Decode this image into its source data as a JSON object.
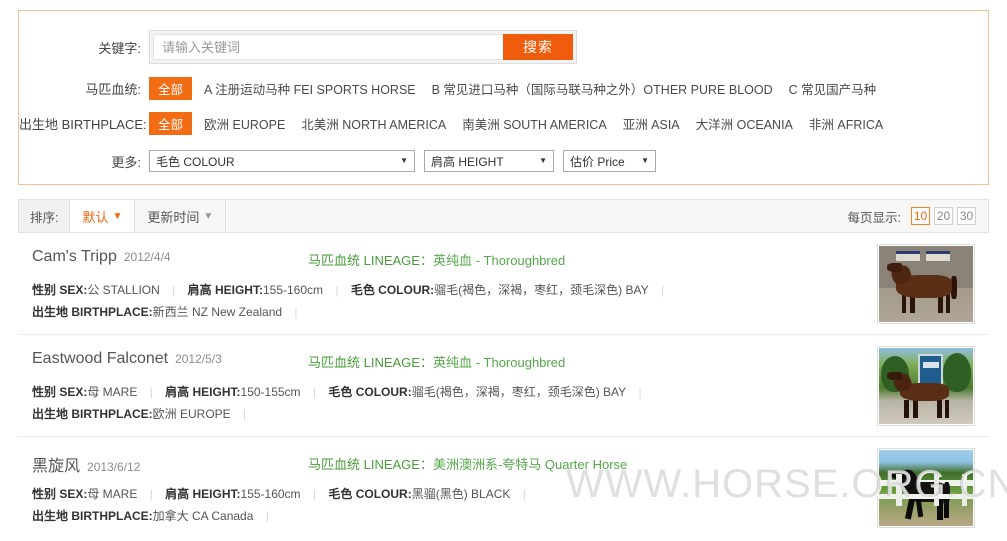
{
  "search": {
    "keyword_label": "关键字:",
    "placeholder": "请输入关键词",
    "value": "",
    "button_label": "搜索"
  },
  "filters": {
    "lineage": {
      "label": "马匹血统:",
      "options": [
        "全部",
        "A 注册运动马种 FEI SPORTS HORSE",
        "B 常见进口马种（国际马联马种之外）OTHER PURE BLOOD",
        "C 常见国产马种"
      ],
      "selected": "全部"
    },
    "birthplace": {
      "label": "出生地 BIRTHPLACE:",
      "options": [
        "全部",
        "欧洲 EUROPE",
        "北美洲 NORTH AMERICA",
        "南美洲 SOUTH AMERICA",
        "亚洲 ASIA",
        "大洋洲 OCEANIA",
        "非洲 AFRICA"
      ],
      "selected": "全部"
    },
    "more": {
      "label": "更多:",
      "selects": [
        {
          "name": "colour",
          "value": "毛色 COLOUR"
        },
        {
          "name": "height",
          "value": "肩高 HEIGHT"
        },
        {
          "name": "price",
          "value": "估价 Price"
        }
      ]
    }
  },
  "sortbar": {
    "label": "排序:",
    "items": [
      {
        "label": "默认",
        "arrow": "▼",
        "active": true
      },
      {
        "label": "更新时间",
        "arrow": "▼",
        "active": false
      }
    ],
    "perpage_label": "每页显示:",
    "perpage_options": [
      "10",
      "20",
      "30"
    ],
    "perpage_selected": "10",
    "accent_color": "#f4690e"
  },
  "labels": {
    "lineage_prefix": "马匹血统 LINEAGE：",
    "sex": "性别 SEX:",
    "height": "肩高 HEIGHT:",
    "colour": "毛色 COLOUR:",
    "birthplace": "出生地 BIRTHPLACE:"
  },
  "listings": [
    {
      "name": "Cam's Tripp",
      "date": "2012/4/4",
      "lineage": "英纯血 - Thoroughbred",
      "sex": "公 STALLION",
      "height": "155-160cm",
      "colour": "骝毛(褐色，深褐，枣红，颈毛深色) BAY",
      "birthplace": "新西兰 NZ New Zealand"
    },
    {
      "name": "Eastwood Falconet",
      "date": "2012/5/3",
      "lineage": "英纯血 - Thoroughbred",
      "sex": "母 MARE",
      "height": "150-155cm",
      "colour": "骝毛(褐色，深褐，枣红，颈毛深色) BAY",
      "birthplace": "欧洲 EUROPE"
    },
    {
      "name": "黑旋风",
      "date": "2013/6/12",
      "lineage": "美洲澳洲系-夸特马 Quarter Horse",
      "sex": "母 MARE",
      "height": "155-160cm",
      "colour": "黑骝(黑色) BLACK",
      "birthplace": "加拿大 CA Canada"
    }
  ],
  "watermark": "WWW.HORSE.ORG.CN"
}
